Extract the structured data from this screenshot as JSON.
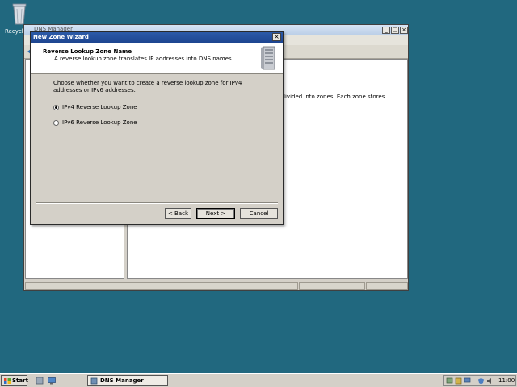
{
  "desktop": {
    "recycle_bin_label": "Recycl"
  },
  "dns_window": {
    "title": "DNS Manager",
    "content_text": "e divided into zones. Each zone stores"
  },
  "wizard": {
    "title": "New Zone Wizard",
    "header_title": "Reverse Lookup Zone Name",
    "header_subtitle": "A reverse lookup zone translates IP addresses into DNS names.",
    "prompt": "Choose whether you want to create a reverse lookup zone for IPv4 addresses or IPv6 addresses.",
    "options": [
      {
        "label": "IPv4 Reverse Lookup Zone",
        "selected": true
      },
      {
        "label": "IPv6 Reverse Lookup Zone",
        "selected": false
      }
    ],
    "buttons": {
      "back": "< Back",
      "next": "Next >",
      "cancel": "Cancel"
    },
    "close_glyph": "×"
  },
  "taskbar": {
    "start_label": "Start",
    "task_label": "DNS Manager",
    "clock": "11:00"
  },
  "colors": {
    "desktop": "#21687f",
    "title_bar": "#1d4590"
  }
}
